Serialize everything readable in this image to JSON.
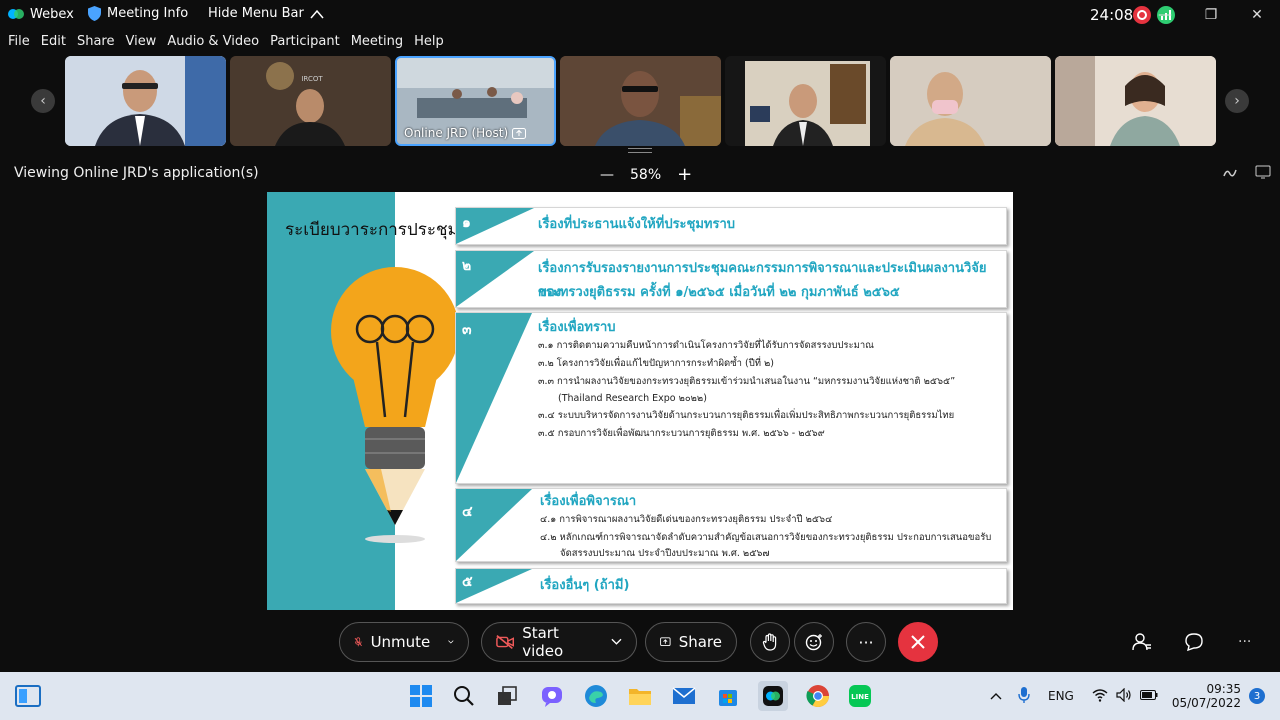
{
  "titlebar": {
    "app_name": "Webex",
    "meeting_info": "Meeting Info",
    "hide_menu": "Hide Menu Bar",
    "timer": "24:08"
  },
  "menu": [
    "File",
    "Edit",
    "Share",
    "View",
    "Audio & Video",
    "Participant",
    "Meeting",
    "Help"
  ],
  "participants": [
    {
      "label": ""
    },
    {
      "label": ""
    },
    {
      "label": "Online JRD (Host)"
    },
    {
      "label": ""
    },
    {
      "label": ""
    },
    {
      "label": ""
    },
    {
      "label": ""
    }
  ],
  "viewbar": {
    "viewing_text": "Viewing Online JRD's application(s)",
    "zoom_minus": "—",
    "zoom_level": "58%",
    "zoom_plus": "+"
  },
  "slide": {
    "title": "ระเบียบวาระการประชุม",
    "items": [
      {
        "num": "๑",
        "title": "เรื่องที่ประธานแจ้งให้ที่ประชุมทราบ",
        "subs": []
      },
      {
        "num": "๒",
        "title": "เรื่องการรับรองรายงานการประชุมคณะกรรมการพิจารณาและประเมินผลงานวิจัยของ",
        "title2": "กระทรวงยุติธรรม ครั้งที่ ๑/๒๕๖๕ เมื่อวันที่ ๒๒ กุมภาพันธ์ ๒๕๖๕",
        "subs": []
      },
      {
        "num": "๓",
        "title": "เรื่องเพื่อทราบ",
        "subs": [
          "๓.๑ การติดตามความคืบหน้าการดำเนินโครงการวิจัยที่ได้รับการจัดสรรงบประมาณ",
          "๓.๒ โครงการวิจัยเพื่อแก้ไขปัญหาการกระทำผิดซ้ำ (ปีที่ ๒)",
          "๓.๓ การนำผลงานวิจัยของกระทรวงยุติธรรมเข้าร่วมนำเสนอในงาน “มหกรรมงานวิจัยแห่งชาติ ๒๕๖๕”",
          "(Thailand Research Expo ๒๐๒๒)",
          "๓.๔ ระบบบริหารจัดการงานวิจัยด้านกระบวนการยุติธรรมเพื่อเพิ่มประสิทธิภาพกระบวนการยุติธรรมไทย",
          "๓.๕ กรอบการวิจัยเพื่อพัฒนากระบวนการยุติธรรม พ.ศ. ๒๕๖๖ - ๒๕๖๙"
        ]
      },
      {
        "num": "๔",
        "title": "เรื่องเพื่อพิจารณา",
        "subs": [
          "๔.๑ การพิจารณาผลงานวิจัยดีเด่นของกระทรวงยุติธรรม ประจำปี ๒๕๖๔",
          "๔.๒ หลักเกณฑ์การพิจารณาจัดลำดับความสำคัญข้อเสนอการวิจัยของกระทรวงยุติธรรม ประกอบการเสนอขอรับ",
          "จัดสรรงบประมาณ ประจำปีงบประมาณ พ.ศ. ๒๕๖๗"
        ]
      },
      {
        "num": "๕",
        "title": "เรื่องอื่นๆ (ถ้ามี)",
        "subs": []
      }
    ]
  },
  "controls": {
    "unmute": "Unmute",
    "start_video": "Start video",
    "share": "Share",
    "more": "···"
  },
  "taskbar": {
    "language": "ENG",
    "time": "09:35",
    "date": "05/07/2022",
    "notification_count": "3"
  },
  "colors": {
    "teal": "#3aa9b3",
    "item_title": "#21a6c1",
    "end_call": "#e5333f",
    "active_border": "#4aa3ff"
  }
}
